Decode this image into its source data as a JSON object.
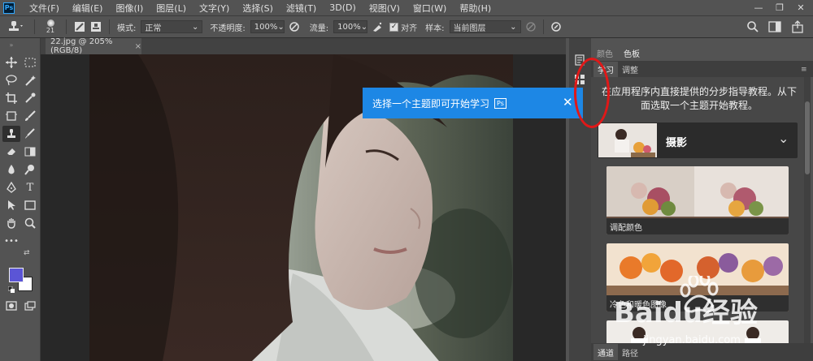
{
  "menubar": {
    "logo": "Ps",
    "items": [
      "文件(F)",
      "编辑(E)",
      "图像(I)",
      "图层(L)",
      "文字(Y)",
      "选择(S)",
      "滤镜(T)",
      "3D(D)",
      "视图(V)",
      "窗口(W)",
      "帮助(H)"
    ],
    "window_controls": [
      "—",
      "❐",
      "✕"
    ]
  },
  "options": {
    "brush_size": "21",
    "mode_label": "模式:",
    "mode_value": "正常",
    "opacity_label": "不透明度:",
    "opacity_value": "100%",
    "flow_label": "流量:",
    "flow_value": "100%",
    "align_label": "对齐",
    "sample_label": "样本:",
    "sample_value": "当前图层"
  },
  "document": {
    "tab_title": "22.jpg @ 205%(RGB/8)",
    "close": "×"
  },
  "panel": {
    "top_tabs": [
      "颜色",
      "色板"
    ],
    "tabs": [
      "学习",
      "调整"
    ],
    "intro": "在应用程序内直接提供的分步指导教程。从下面选取一个主题开始教程。",
    "topic_title": "摄影",
    "cards": [
      {
        "caption": "调配颜色"
      },
      {
        "caption": "冷色和暖色图像"
      },
      {
        "caption": ""
      }
    ],
    "bottom_tabs": [
      "通道",
      "路径"
    ]
  },
  "tooltip": {
    "text": "选择一个主题即可开始学习",
    "badge": "Ps",
    "close": "✕"
  },
  "watermark": {
    "brand": "Baidu经验",
    "url": "jingyan.baidu.com"
  },
  "colors": {
    "foreground": "#5b55d6",
    "background": "#ffffff",
    "accent": "#1d87e5",
    "highlight_circle": "#e01818"
  },
  "icons": {
    "stamp": "clone-stamp-icon",
    "search": "search-icon",
    "workspace": "workspace-icon",
    "share": "share-icon"
  }
}
